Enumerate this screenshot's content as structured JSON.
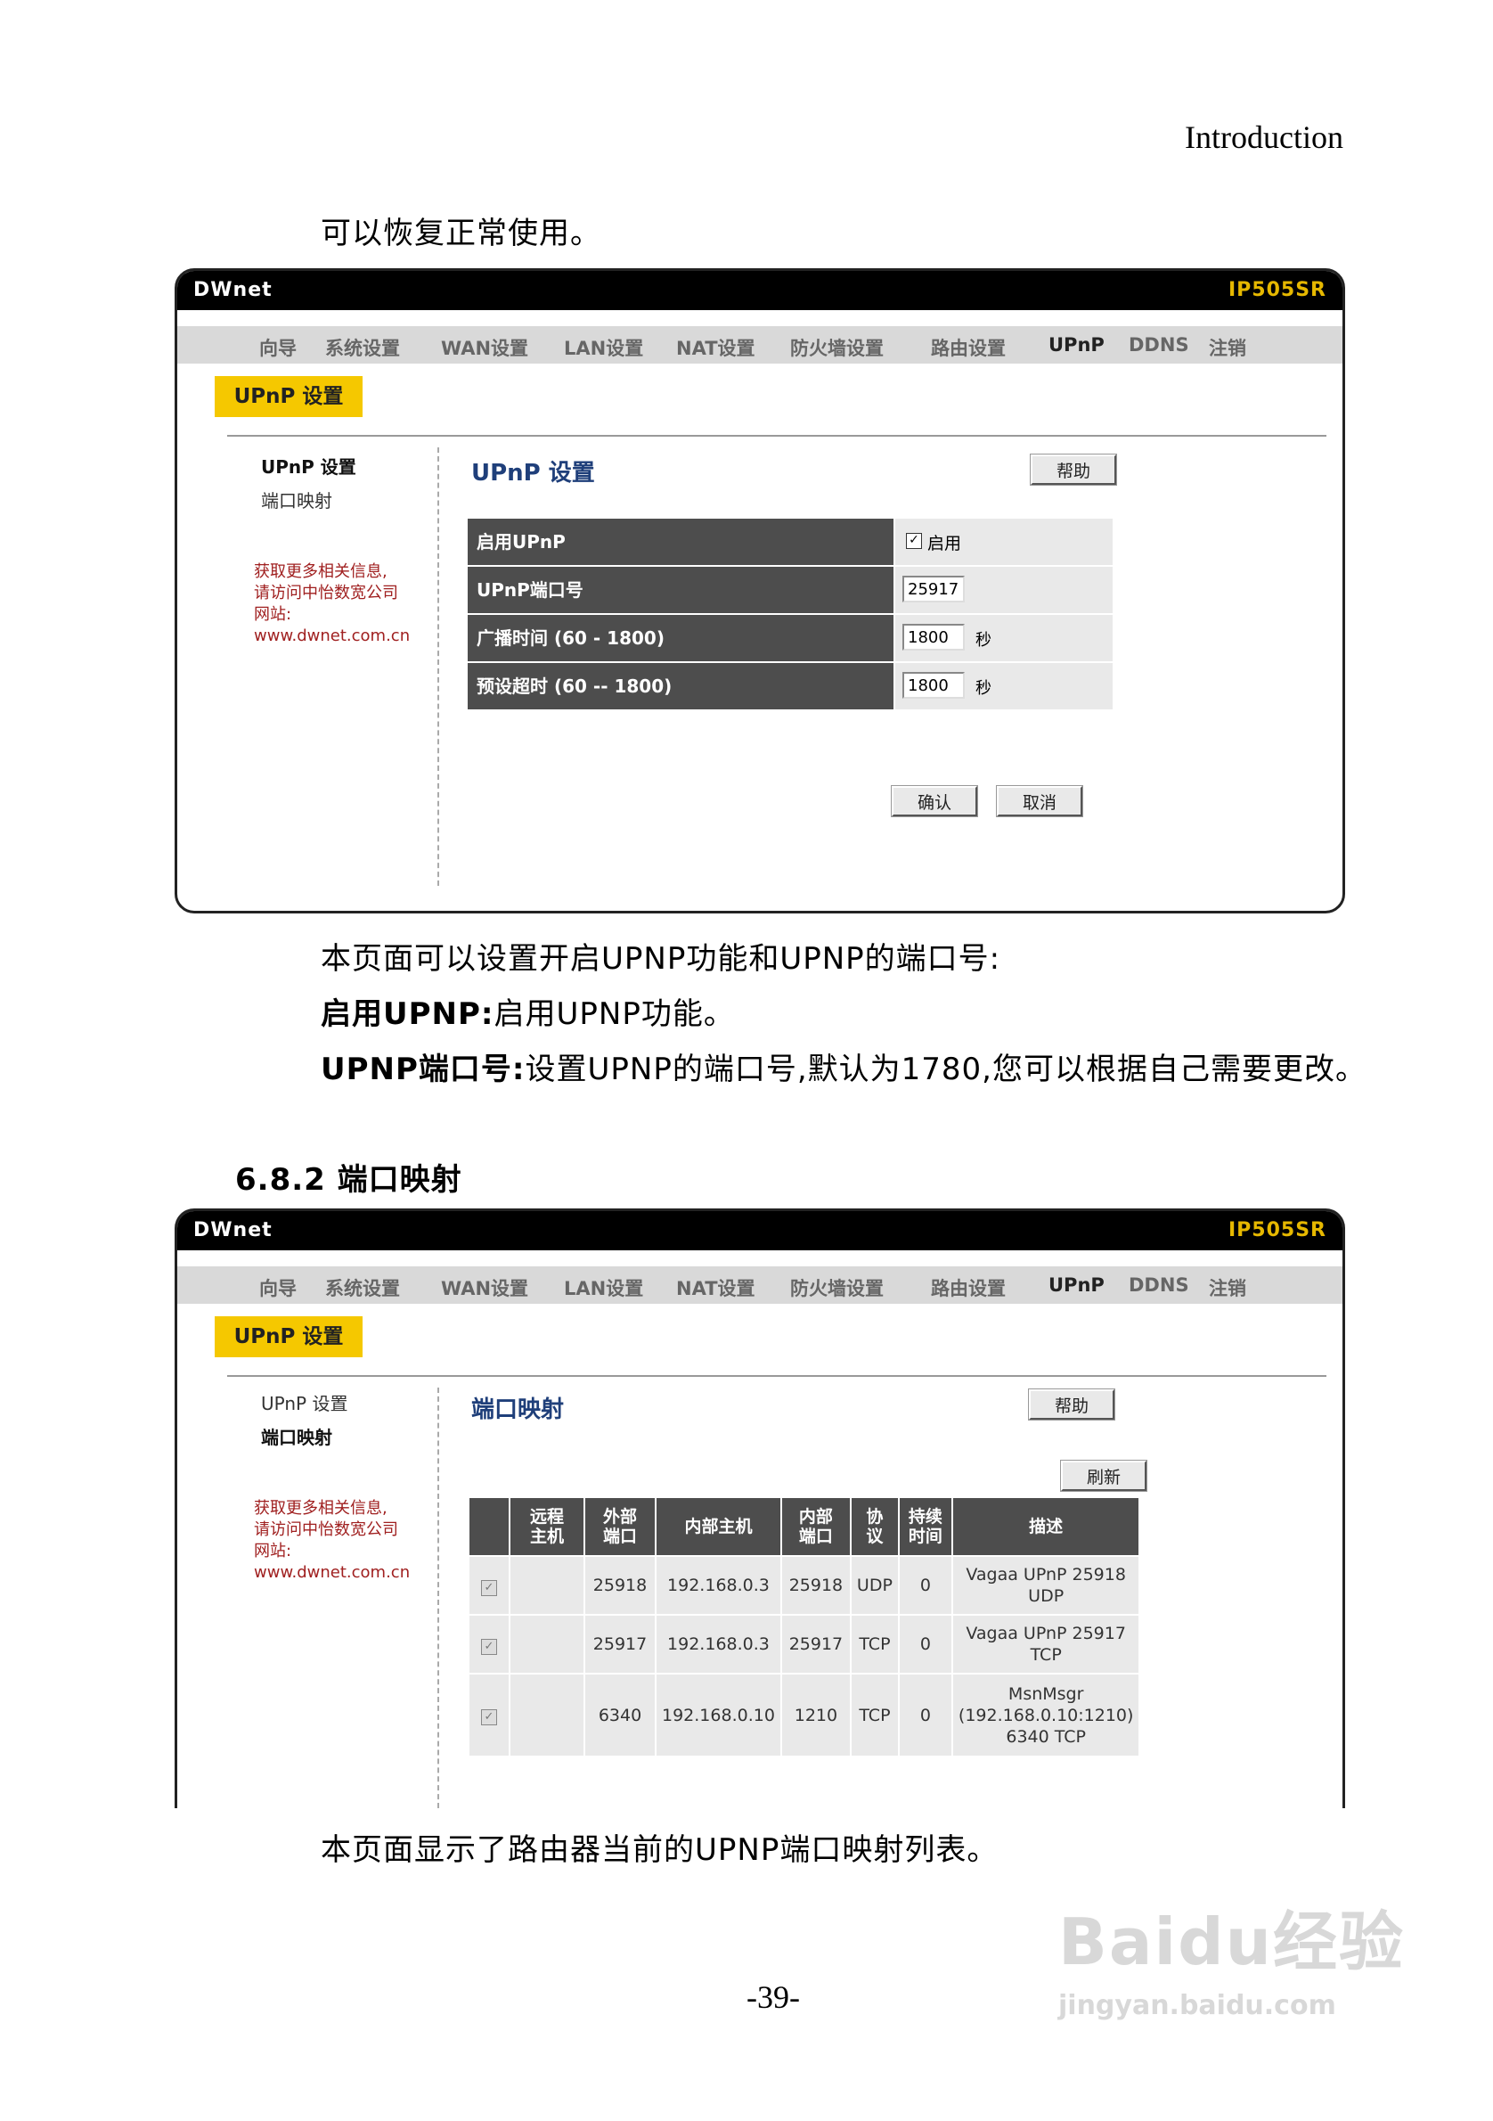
{
  "header": {
    "right": "Introduction"
  },
  "intro_line": "可以恢复正常使用。",
  "screen": {
    "brand": "DWnet",
    "model": "IP505SR",
    "nav": [
      "向导",
      "系统设置",
      "WAN设置",
      "LAN设置",
      "NAT设置",
      "防火墙设置",
      "路由设置",
      "UPnP",
      "DDNS",
      "注销"
    ],
    "badge": "UPnP 设置",
    "side_links": [
      "UPnP 设置",
      "端口映射"
    ],
    "side_info": [
      "获取更多相关信息,",
      "请访问中怡数宽公司",
      "网站:",
      "www.dwnet.com.cn"
    ],
    "help": "帮助"
  },
  "upnp_settings": {
    "title": "UPnP 设置",
    "rows": [
      {
        "label": "启用UPnP",
        "check_label": "启用"
      },
      {
        "label": "UPnP端口号",
        "value": "25917"
      },
      {
        "label": "广播时间 (60 - 1800)",
        "value": "1800",
        "unit": "秒"
      },
      {
        "label": "预设超时 (60 -- 1800)",
        "value": "1800",
        "unit": "秒"
      }
    ],
    "confirm": "确认",
    "cancel": "取消"
  },
  "desc1": {
    "line1": "本页面可以设置开启UPNP功能和UPNP的端口号:",
    "line2_bold": "启用UPNP:",
    "line2": "启用UPNP功能。",
    "line3_bold": "UPNP端口号:",
    "line3": "设置UPNP的端口号,默认为1780,您可以根据自己需要更改。"
  },
  "section2_title": "6.8.2 端口映射",
  "port_mapping": {
    "title": "端口映射",
    "refresh": "刷新",
    "headers": [
      "",
      "远程\n主机",
      "外部\n端口",
      "内部主机",
      "内部\n端口",
      "协\n议",
      "持续\n时间",
      "描述"
    ],
    "rows": [
      [
        "",
        "25918",
        "192.168.0.3",
        "25918",
        "UDP",
        "0",
        "Vagaa UPnP 25918\nUDP"
      ],
      [
        "",
        "25917",
        "192.168.0.3",
        "25917",
        "TCP",
        "0",
        "Vagaa UPnP 25917\nTCP"
      ],
      [
        "",
        "6340",
        "192.168.0.10",
        "1210",
        "TCP",
        "0",
        "MsnMsgr\n(192.168.0.10:1210)\n6340 TCP"
      ]
    ]
  },
  "desc2": "本页面显示了路由器当前的UPNP端口映射列表。",
  "watermark": {
    "line1": "Baidu经验",
    "line2": "jingyan.baidu.com"
  },
  "page_number": "-39-"
}
